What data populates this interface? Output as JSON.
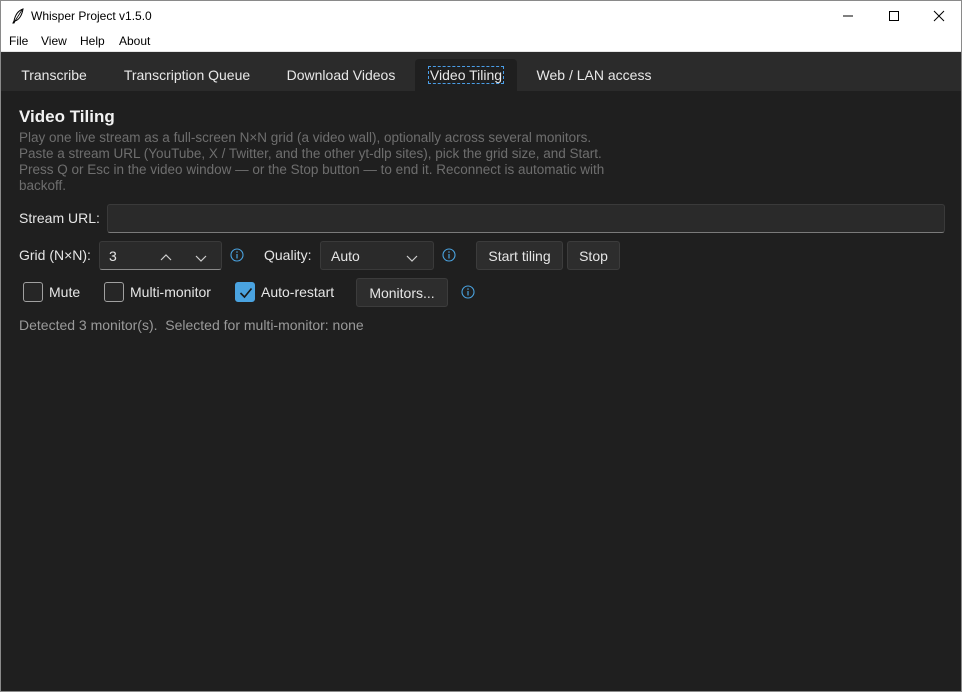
{
  "window": {
    "title": "Whisper Project v1.5.0",
    "icon": "feather-icon"
  },
  "menu": [
    "File",
    "View",
    "Help",
    "About"
  ],
  "tabs": [
    {
      "label": "Transcribe",
      "active": false
    },
    {
      "label": "Transcription Queue",
      "active": false
    },
    {
      "label": "Download Videos",
      "active": false
    },
    {
      "label": "Video Tiling",
      "active": true
    },
    {
      "label": "Web / LAN access",
      "active": false
    }
  ],
  "tiling": {
    "title": "Video Tiling",
    "description": [
      "Play one live stream as a full-screen N×N grid (a video wall), optionally across several monitors.",
      "Paste a stream URL (YouTube, X / Twitter, and the other yt-dlp sites), pick the grid size, and Start.",
      "Press Q or Esc in the video window — or the Stop button — to end it. Reconnect is automatic with",
      "backoff."
    ],
    "url_label": "Stream URL:",
    "url_value": "",
    "grid_label": "Grid (N×N):",
    "grid_value": "3",
    "quality_label": "Quality:",
    "quality_value": "Auto",
    "start_label": "Start tiling",
    "stop_label": "Stop",
    "mute_label": "Mute",
    "mute_checked": false,
    "multi_label": "Multi-monitor",
    "multi_checked": false,
    "autorestart_label": "Auto-restart",
    "autorestart_checked": true,
    "monitors_label": "Monitors...",
    "status": "Detected 3 monitor(s).  Selected for multi-monitor: none"
  },
  "colors": {
    "accent": "#4aa3e0",
    "background": "#1f1f1f",
    "tabbar": "#2b2b2b"
  }
}
